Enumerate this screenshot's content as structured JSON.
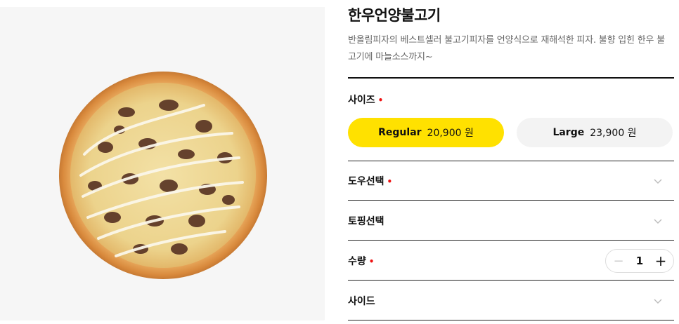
{
  "product": {
    "title": "한우언양불고기",
    "description": "반올림피자의 베스트셀러 불고기피자를 언양식으로 재해석한 피자. 불향 입힌 한우 불고기에 마늘소스까지~"
  },
  "options": {
    "required_mark": "•",
    "size": {
      "label": "사이즈",
      "choices": [
        {
          "name": "Regular",
          "price": "20,900 원",
          "selected": true
        },
        {
          "name": "Large",
          "price": "23,900 원",
          "selected": false
        }
      ]
    },
    "dough": {
      "label": "도우선택"
    },
    "topping": {
      "label": "토핑선택"
    },
    "quantity": {
      "label": "수량",
      "value": "1",
      "minus": "−",
      "plus": "+"
    },
    "side": {
      "label": "사이드"
    }
  },
  "colors": {
    "accent": "#ffe100",
    "required": "#e11111"
  }
}
